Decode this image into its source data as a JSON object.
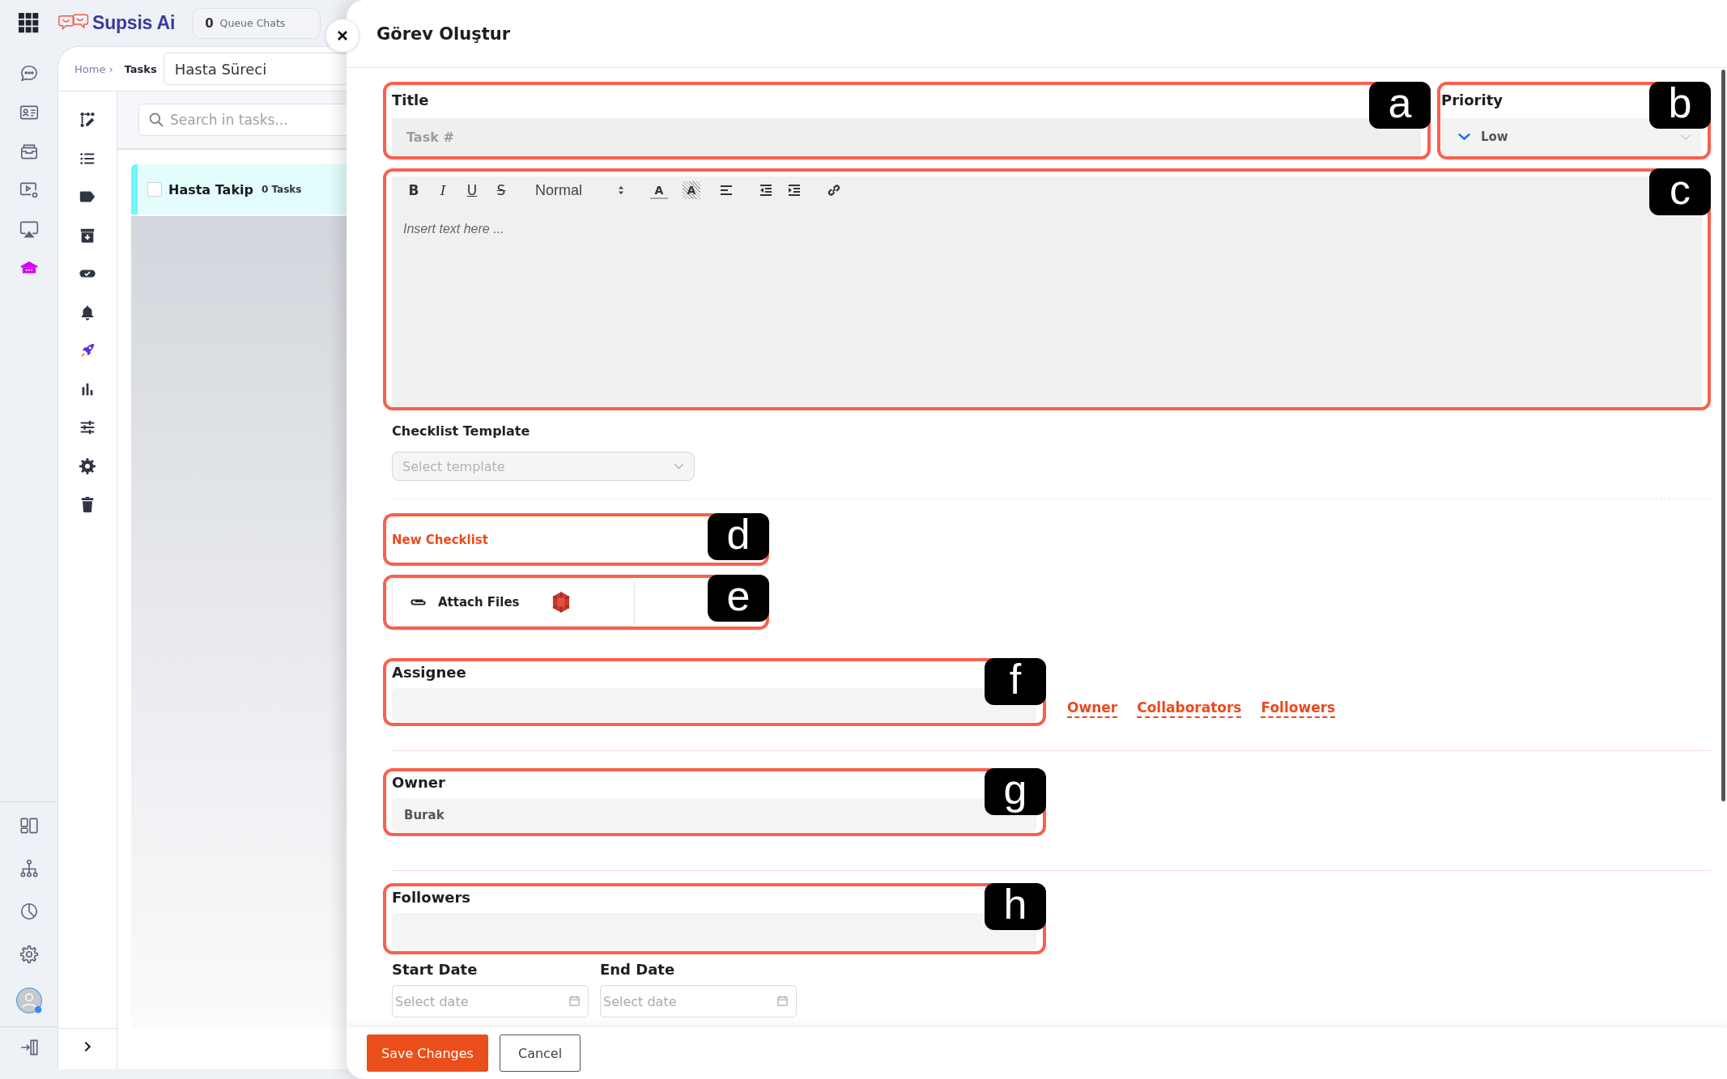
{
  "app_bar": {
    "brand": "Supsis Ai",
    "queue_count": "0",
    "queue_label": "Queue Chats"
  },
  "breadcrumb": {
    "items": [
      {
        "label": "Home",
        "current": false
      },
      {
        "label": "Tasks",
        "current": true
      }
    ],
    "separator": "›"
  },
  "board_name": {
    "value": "Hasta Süreci"
  },
  "task_search": {
    "placeholder": "Search in tasks..."
  },
  "task_lists": [
    {
      "name": "Hasta Takip",
      "count": "0 Tasks",
      "checked": false
    }
  ],
  "modal": {
    "title": "Görev Oluştur"
  },
  "form": {
    "title": {
      "label": "Title",
      "placeholder": "Task #",
      "callout": "a"
    },
    "priority": {
      "label": "Priority",
      "value": "Low",
      "callout": "b"
    },
    "description": {
      "toolbar": [
        {
          "kind": "bold",
          "glyph": "B"
        },
        {
          "kind": "italic",
          "glyph": "I"
        },
        {
          "kind": "underline",
          "glyph": "U"
        },
        {
          "kind": "strike",
          "glyph": "S"
        },
        {
          "kind": "header",
          "value": "Normal"
        },
        {
          "kind": "color",
          "glyph": "A"
        },
        {
          "kind": "background",
          "glyph": "A"
        },
        {
          "kind": "align"
        },
        {
          "kind": "outdent"
        },
        {
          "kind": "indent"
        },
        {
          "kind": "link"
        }
      ],
      "placeholder": "Insert text here ...",
      "callout": "c"
    },
    "checklist_template": {
      "label": "Checklist Template",
      "placeholder": "Select template"
    },
    "new_checklist": {
      "label": "New Checklist",
      "callout": "d"
    },
    "attach_files": {
      "label": "Attach Files",
      "callout": "e"
    },
    "assignee": {
      "label": "Assignee",
      "callout": "f"
    },
    "role_links": [
      {
        "label": "Owner"
      },
      {
        "label": "Collaborators"
      },
      {
        "label": "Followers"
      }
    ],
    "owner": {
      "label": "Owner",
      "value": "Burak",
      "callout": "g"
    },
    "followers": {
      "label": "Followers",
      "callout": "h"
    },
    "dates": [
      {
        "label": "Start Date",
        "placeholder": "Select date"
      },
      {
        "label": "End Date",
        "placeholder": "Select date"
      }
    ]
  },
  "footer": {
    "buttons": [
      {
        "label": "Save Changes",
        "kind": "primary"
      },
      {
        "label": "Cancel",
        "kind": "secondary"
      }
    ]
  }
}
